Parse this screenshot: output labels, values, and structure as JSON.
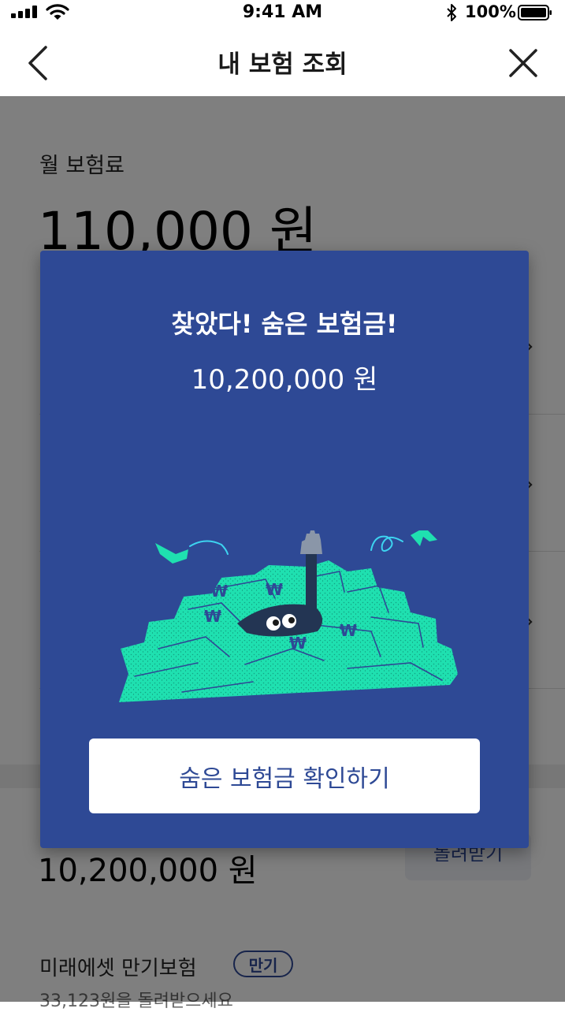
{
  "status_bar": {
    "time": "9:41 AM",
    "battery": "100%"
  },
  "nav": {
    "title": "내 보험 조회"
  },
  "page": {
    "premium_label": "월 보험료",
    "premium_value": "110,000 원",
    "hidden_amount": "10,200,000 원",
    "receive_button": "돌려받기",
    "product": {
      "name": "미래에셋 만기보험",
      "badge": "만기",
      "desc": "33,123원을 돌려받으세요"
    }
  },
  "modal": {
    "title": "찾았다! 숨은 보험금!",
    "amount": "10,200,000 원",
    "button": "숨은 보험금 확인하기"
  },
  "colors": {
    "modal_bg": "#2e4995",
    "money_green": "#1fe0b0",
    "accent_blue": "#2e4995"
  },
  "icons": [
    "signal-icon",
    "wifi-icon",
    "bluetooth-icon",
    "battery-icon",
    "back-arrow-icon",
    "close-icon"
  ]
}
